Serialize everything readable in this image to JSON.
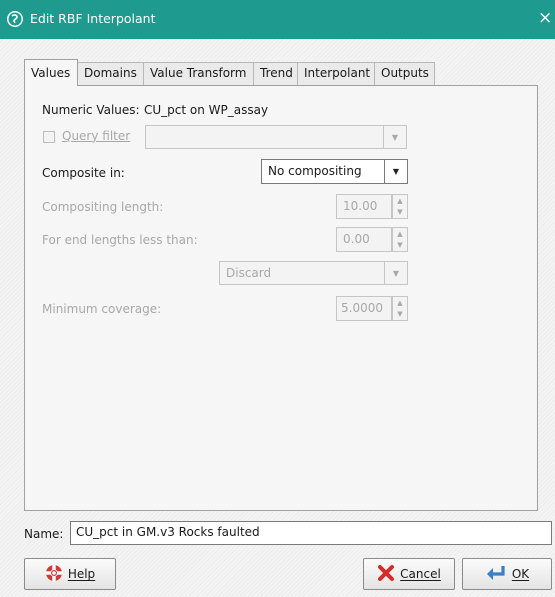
{
  "window": {
    "title": "Edit RBF Interpolant",
    "close_glyph": "×"
  },
  "tabs": [
    {
      "label": "Values",
      "active": true
    },
    {
      "label": "Domains"
    },
    {
      "label": "Value Transform"
    },
    {
      "label": "Trend"
    },
    {
      "label": "Interpolant"
    },
    {
      "label": "Outputs"
    }
  ],
  "values_tab": {
    "numeric_values_label": "Numeric Values:",
    "numeric_values_value": "CU_pct on WP_assay",
    "query_filter_label": "Query filter",
    "query_filter_value": "",
    "composite_in_label": "Composite in:",
    "composite_in_value": "No compositing",
    "compositing_length_label": "Compositing length:",
    "compositing_length_value": "10.00",
    "end_lengths_label": "For end lengths less than:",
    "end_lengths_value": "0.00",
    "end_action_value": "Discard",
    "minimum_coverage_label": "Minimum coverage:",
    "minimum_coverage_value": "5.0000"
  },
  "name": {
    "label": "Name:",
    "value": "CU_pct in GM.v3 Rocks faulted"
  },
  "buttons": {
    "help": "Help",
    "cancel": "Cancel",
    "ok": "OK"
  },
  "colors": {
    "titlebar": "#1f9a8e",
    "disabled_text": "#a8a8a8"
  },
  "icons": {
    "app": "leapfrog-logo-icon",
    "help": "lifebuoy-icon",
    "cancel": "red-x-icon",
    "ok": "return-arrow-icon"
  }
}
